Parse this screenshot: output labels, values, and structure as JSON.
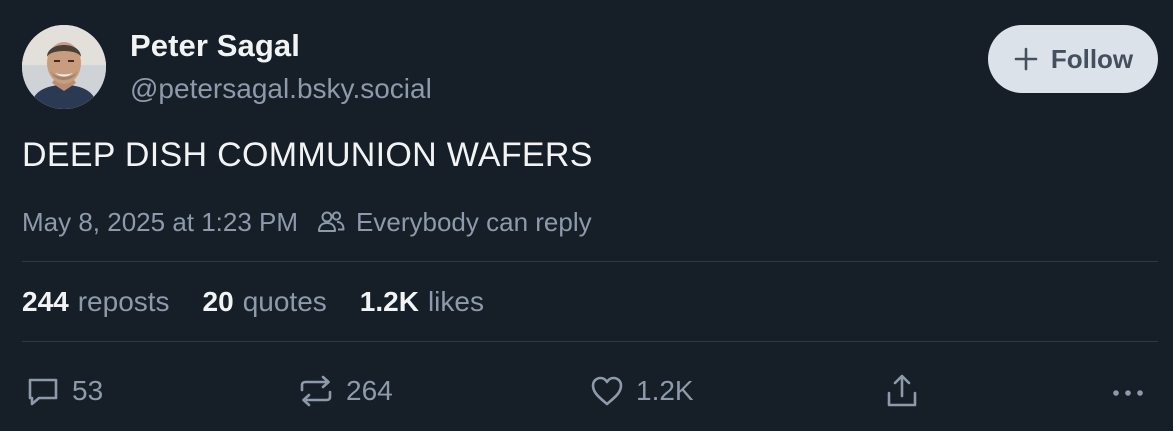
{
  "author": {
    "display_name": "Peter Sagal",
    "handle": "@petersagal.bsky.social"
  },
  "follow_button": {
    "label": "Follow",
    "icon": "plus-icon"
  },
  "post": {
    "text": "DEEP DISH COMMUNION WAFERS",
    "timestamp": "May 8, 2025 at 1:23 PM",
    "reply_setting": "Everybody can reply"
  },
  "stats": [
    {
      "value": "244",
      "label": "reposts"
    },
    {
      "value": "20",
      "label": "quotes"
    },
    {
      "value": "1.2K",
      "label": "likes"
    }
  ],
  "actions": {
    "reply_count": "53",
    "repost_count": "264",
    "like_count": "1.2K"
  },
  "colors": {
    "background": "#161e27",
    "primary_text": "#f1f3f5",
    "secondary_text": "#8d9aab",
    "follow_button_bg": "#dce2ea",
    "divider": "#2e3947"
  }
}
